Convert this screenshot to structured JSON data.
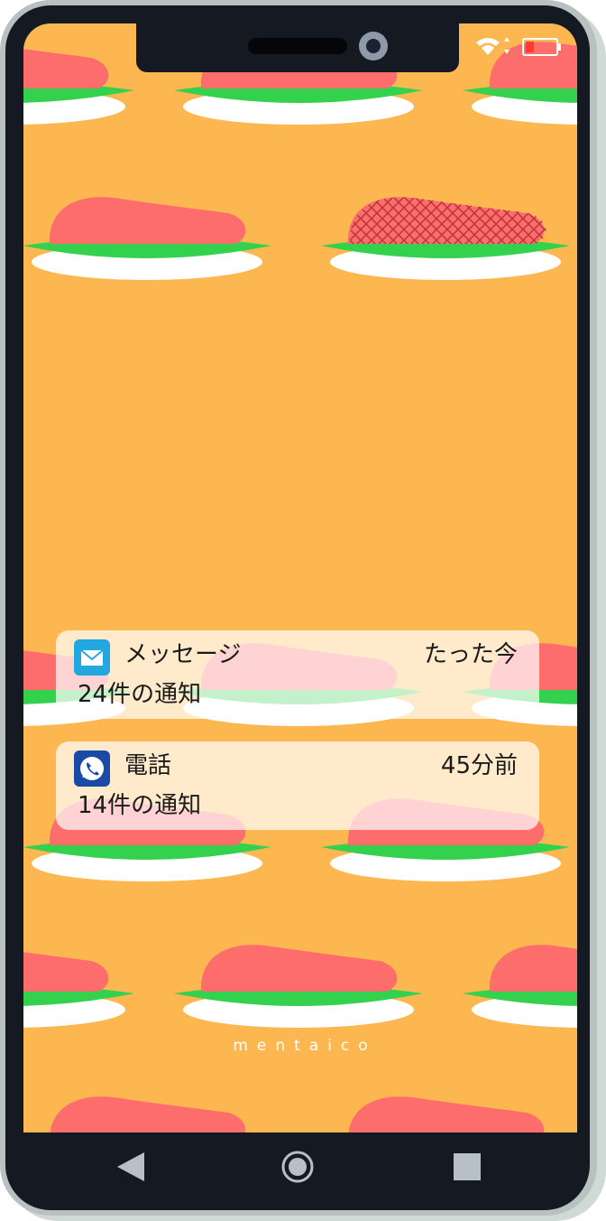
{
  "wallpaper": {
    "brand": "mentaico",
    "colors": {
      "background": "#fdb751",
      "mentaiko": "#fd6d6b",
      "leaf": "#33d14d",
      "plate": "#ffffff"
    }
  },
  "status_bar": {
    "wifi": "wifi-icon",
    "battery": "battery-low-icon"
  },
  "notifications": [
    {
      "app": "メッセージ",
      "time": "たった今",
      "count": "24件の通知",
      "icon": "mail-icon",
      "icon_color": "#22a7e0"
    },
    {
      "app": "電話",
      "time": "45分前",
      "count": "14件の通知",
      "icon": "phone-icon",
      "icon_color": "#1a4aa8"
    }
  ],
  "navigation": {
    "back": "back-icon",
    "home": "home-icon",
    "recents": "recents-icon"
  }
}
